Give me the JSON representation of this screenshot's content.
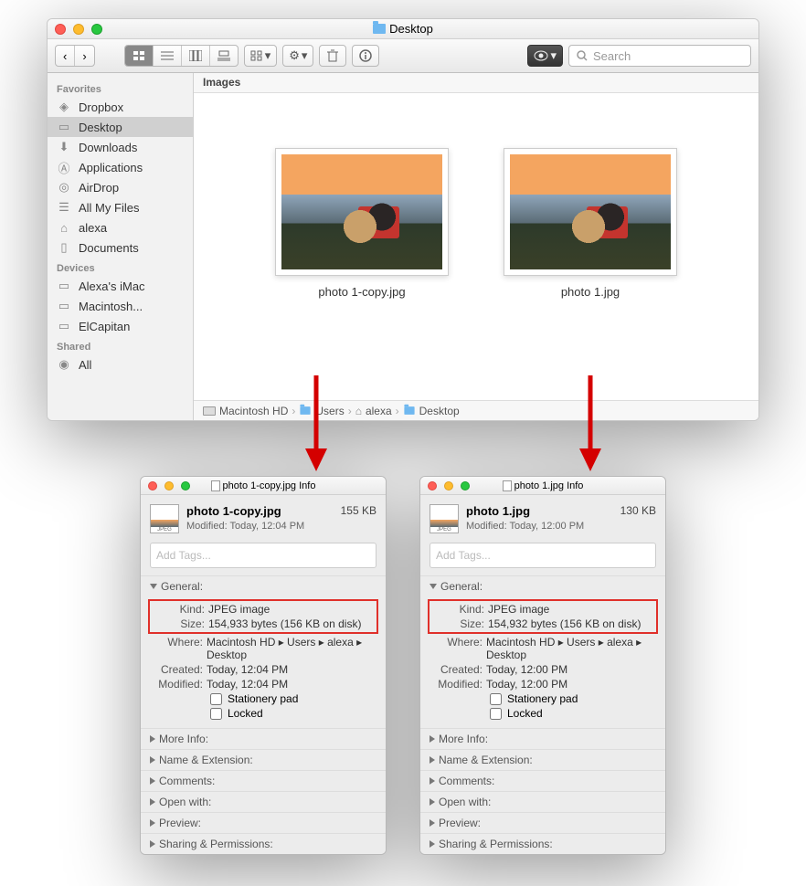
{
  "finder": {
    "title": "Desktop",
    "search_placeholder": "Search",
    "header": "Images",
    "sidebar": {
      "groups": [
        {
          "label": "Favorites",
          "items": [
            "Dropbox",
            "Desktop",
            "Downloads",
            "Applications",
            "AirDrop",
            "All My Files",
            "alexa",
            "Documents"
          ]
        },
        {
          "label": "Devices",
          "items": [
            "Alexa's iMac",
            "Macintosh...",
            "ElCapitan"
          ]
        },
        {
          "label": "Shared",
          "items": [
            "All"
          ]
        }
      ]
    },
    "files": [
      {
        "label": "photo 1-copy.jpg"
      },
      {
        "label": "photo 1.jpg"
      }
    ],
    "pathbar": [
      "Macintosh HD",
      "Users",
      "alexa",
      "Desktop"
    ]
  },
  "panels": [
    {
      "title": "photo 1-copy.jpg Info",
      "filename": "photo 1-copy.jpg",
      "short_size": "155 KB",
      "modified_line": "Modified: Today, 12:04 PM",
      "tags_placeholder": "Add Tags...",
      "general_label": "General:",
      "kind_k": "Kind:",
      "kind_v": "JPEG image",
      "size_k": "Size:",
      "size_v": "154,933 bytes (156 KB on disk)",
      "where_k": "Where:",
      "where_v": "Macintosh HD ▸ Users ▸ alexa ▸ Desktop",
      "created_k": "Created:",
      "created_v": "Today, 12:04 PM",
      "modified_k": "Modified:",
      "modified_v": "Today, 12:04 PM",
      "stationery": "Stationery pad",
      "locked": "Locked",
      "sections": [
        "More Info:",
        "Name & Extension:",
        "Comments:",
        "Open with:",
        "Preview:",
        "Sharing & Permissions:"
      ]
    },
    {
      "title": "photo 1.jpg Info",
      "filename": "photo 1.jpg",
      "short_size": "130 KB",
      "modified_line": "Modified: Today, 12:00 PM",
      "tags_placeholder": "Add Tags...",
      "general_label": "General:",
      "kind_k": "Kind:",
      "kind_v": "JPEG image",
      "size_k": "Size:",
      "size_v": "154,932 bytes (156 KB on disk)",
      "where_k": "Where:",
      "where_v": "Macintosh HD ▸ Users ▸ alexa ▸ Desktop",
      "created_k": "Created:",
      "created_v": "Today, 12:00 PM",
      "modified_k": "Modified:",
      "modified_v": "Today, 12:00 PM",
      "stationery": "Stationery pad",
      "locked": "Locked",
      "sections": [
        "More Info:",
        "Name & Extension:",
        "Comments:",
        "Open with:",
        "Preview:",
        "Sharing & Permissions:"
      ]
    }
  ]
}
